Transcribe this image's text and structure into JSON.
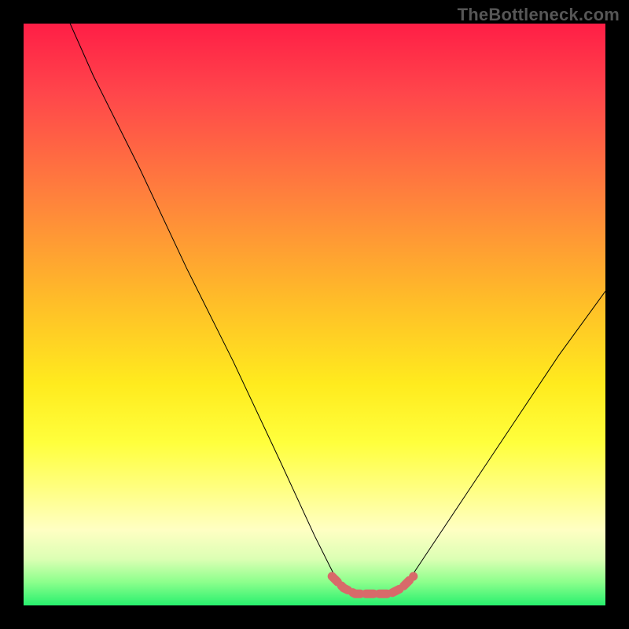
{
  "watermark": "TheBottleneck.com",
  "colors": {
    "background": "#000000",
    "curve": "#000000",
    "marker": "#d86a6a",
    "watermark_text": "#565656"
  },
  "chart_data": {
    "type": "line",
    "title": "",
    "xlabel": "",
    "ylabel": "",
    "xlim": [
      0,
      100
    ],
    "ylim": [
      0,
      100
    ],
    "grid": false,
    "legend": false,
    "description": "V-shaped bottleneck deviation curve over a red-to-green vertical gradient. Lower y = better (green). Minimum (optimal range) sits near x ≈ 55–65 at y ≈ 2. Left branch rises steeply to y=100 at x≈8; right branch rises more gently to y≈54 at x=100.",
    "series": [
      {
        "name": "bottleneck_curve",
        "x": [
          8,
          12,
          20,
          28,
          36,
          44,
          50,
          54,
          56,
          58,
          60,
          62,
          64,
          66,
          70,
          76,
          84,
          92,
          100
        ],
        "y": [
          100,
          91,
          75,
          58,
          42,
          25,
          12,
          4,
          2,
          2,
          2,
          2,
          2,
          4,
          10,
          19,
          31,
          43,
          54
        ]
      }
    ],
    "marker": {
      "description": "Highlighted optimal sweet-spot segment along valley floor",
      "x": [
        53,
        55,
        57,
        59,
        61,
        63,
        65,
        67
      ],
      "y": [
        5,
        3,
        2,
        2,
        2,
        2,
        3,
        5
      ],
      "stroke_width_px": 11,
      "dash": [
        10,
        7
      ]
    }
  }
}
